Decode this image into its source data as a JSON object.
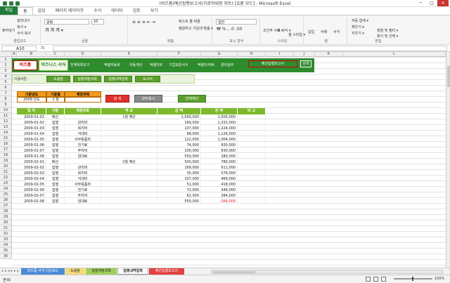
{
  "window": {
    "title": "(비즈폼)예산집행보고서(가로막대형 차트) [호환 모드] - Microsoft Excel",
    "min": "─",
    "max": "□",
    "close": "✕"
  },
  "ribbon_tabs": [
    "파일",
    "홈",
    "삽입",
    "페이지 레이아웃",
    "수식",
    "데이터",
    "검토",
    "보기"
  ],
  "ribbon": {
    "paste": "붙여넣기",
    "cut": "잘라내기",
    "copy": "복사 ▾",
    "format_painter": "서식 복사",
    "font_name": "굴림",
    "font_size": "10",
    "wrap": "텍스트 줄 바꿈",
    "merge": "병합하고 가운데 맞춤 ▾",
    "number_format": "일반",
    "cond": "조건부 서식 ▾",
    "table": "표 서식 ▾",
    "cellstyle": "셀 스타일 ▾",
    "insert": "삽입",
    "delete": "삭제",
    "format": "서식",
    "autosum": "자동 합계 ▾",
    "fill": "채우기 ▾",
    "clear": "지우기 ▾",
    "sort": "정렬 및 필터 ▾",
    "find": "찾기 및 선택 ▾",
    "groups": [
      "클립보드",
      "글꼴",
      "맞춤",
      "표시 형식",
      "스타일",
      "셀",
      "편집"
    ]
  },
  "formula": {
    "namebox": "A10",
    "fx": "fx",
    "value": ""
  },
  "columns": [
    "A",
    "B",
    "C",
    "D",
    "E",
    "F",
    "G",
    "H",
    "I",
    "J",
    "K",
    "L"
  ],
  "rows": [
    "1",
    "2",
    "3",
    "4",
    "5",
    "6",
    "7",
    "8",
    "9",
    "10",
    "11",
    "12",
    "13",
    "14",
    "15",
    "16",
    "17",
    "18",
    "19",
    "20",
    "21",
    "22",
    "23",
    "24",
    "25",
    "26",
    "27",
    "28",
    "29",
    "30",
    "31",
    "32",
    "33",
    "34",
    "35",
    "36"
  ],
  "sheet": {
    "logo": "비즈폼",
    "logo2": "비즈니스 서식",
    "menu": [
      "전체목록보기",
      "엑셀자동화",
      "자동계산",
      "엑셀차트",
      "기업표준서식",
      "엑셀지식IN",
      "경리실무"
    ],
    "report_title": "예산집행보고서",
    "report_search": "검색",
    "subnav_label": "이동버튼 :",
    "subnav": [
      "도움말",
      "집행계정과목",
      "집행내역입력",
      "보고서"
    ],
    "info_headers": [
      "기준년도",
      "기준월",
      "계정과목"
    ],
    "info_values": [
      "2009 년도",
      "2 월",
      ""
    ],
    "btn_search": "검 색",
    "btn_showall": "모두표시",
    "btn_print": "전체계산"
  },
  "table": {
    "headers": [
      "일 자",
      "구분",
      "계정과목",
      "적 요",
      "금 액",
      "잔 액",
      "비 고"
    ],
    "rows": [
      [
        "2009-01-01",
        "배산",
        "",
        "1월 예산",
        "1,500,000",
        "1,500,000",
        ""
      ],
      [
        "2009-01-02",
        "집행",
        "관리비",
        "",
        "169,000",
        "1,331,000",
        ""
      ],
      [
        "2009-01-03",
        "집행",
        "복지비",
        "",
        "107,000",
        "1,224,000",
        ""
      ],
      [
        "2009-01-04",
        "집행",
        "식대비",
        "",
        "98,000",
        "1,126,000",
        ""
      ],
      [
        "2009-01-05",
        "집행",
        "사무용품비",
        "",
        "122,000",
        "1,004,000",
        ""
      ],
      [
        "2009-01-06",
        "집행",
        "전기료",
        "",
        "74,000",
        "930,000",
        ""
      ],
      [
        "2009-01-07",
        "집행",
        "주차비",
        "",
        "100,000",
        "830,000",
        ""
      ],
      [
        "2009-01-08",
        "집행",
        "임대료",
        "",
        "550,000",
        "280,000",
        ""
      ],
      [
        "2009-02-01",
        "배산",
        "",
        "2월 예산",
        "500,000",
        "780,000",
        ""
      ],
      [
        "2009-02-02",
        "집행",
        "관리비",
        "",
        "169,000",
        "611,000",
        ""
      ],
      [
        "2009-02-03",
        "집행",
        "복지비",
        "",
        "35,000",
        "576,000",
        ""
      ],
      [
        "2009-02-04",
        "집행",
        "식대비",
        "",
        "107,000",
        "469,000",
        ""
      ],
      [
        "2009-02-05",
        "집행",
        "사무용품비",
        "",
        "51,000",
        "418,000",
        ""
      ],
      [
        "2009-02-06",
        "집행",
        "전기료",
        "",
        "72,000",
        "346,000",
        ""
      ],
      [
        "2009-02-07",
        "집행",
        "주차비",
        "",
        "62,000",
        "284,000",
        ""
      ],
      [
        "2009-02-08",
        "집행",
        "임대료",
        "",
        "550,000",
        "-266,000",
        ""
      ]
    ]
  },
  "sheet_tabs": [
    "비즈폼 서식 다운로드",
    "도움말",
    "집행계정과목",
    "집행내역입력",
    "예산집행보고서"
  ],
  "status": {
    "ready": "준비",
    "zoom": "100%"
  },
  "colors": {
    "green": "#2e8b2e",
    "header_green": "#7cba2c",
    "orange": "#f39c1c",
    "red": "#e0302c"
  }
}
